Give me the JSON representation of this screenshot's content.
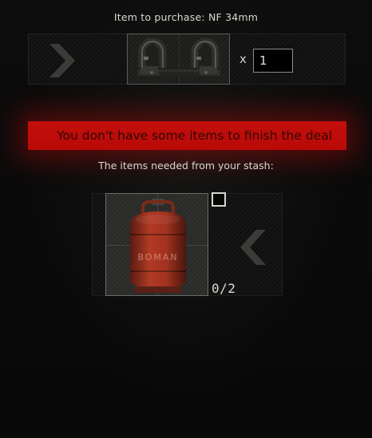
{
  "header": {
    "title": "Item to purchase: NF 34mm"
  },
  "purchase": {
    "item_icon": "scope-mount-icon",
    "quantity_prefix": "x",
    "quantity_value": "1"
  },
  "warning": {
    "message": "You don't have some items to finish the deal",
    "color": "#c40f0c"
  },
  "stash": {
    "label": "The items needed from your stash:",
    "items": [
      {
        "icon": "gas-tank-icon",
        "tank_text": "BOMAN",
        "count": "0/2"
      }
    ]
  },
  "icons": {
    "next": "chevron-right-icon",
    "back": "chevron-left-icon",
    "select": "checkbox-icon"
  }
}
